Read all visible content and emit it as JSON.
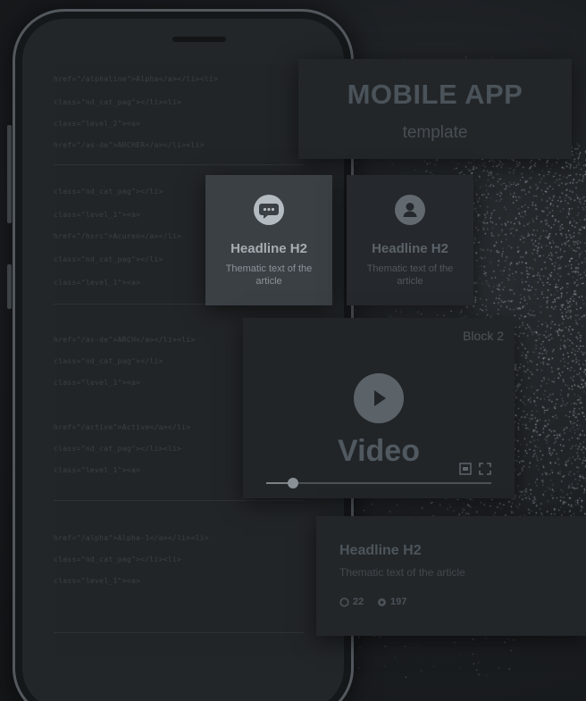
{
  "header": {
    "title": "MOBILE APP",
    "subtitle": "template"
  },
  "features": [
    {
      "icon": "chat-bubble-icon",
      "headline": "Headline H2",
      "text": "Thematic text of the article"
    },
    {
      "icon": "user-icon",
      "headline": "Headline H2",
      "text": "Thematic text of the article"
    }
  ],
  "video_block": {
    "label": "Block 2",
    "title": "Video",
    "progress": 0.12
  },
  "article": {
    "headline": "Headline H2",
    "text": "Thematic text of the article",
    "comments": "22",
    "views": "197"
  },
  "code_lines": [
    "href=\"/alphaline\">Alpha&lt;/a>&lt;/li>&lt;li>",
    "class=\"nd_cat_pag\">&lt;/li>&lt;li>",
    "class=\"level_2\">&lt;a>",
    "href=\"/as-de\">ARCHER&lt;/a>&lt;/li>&lt;li>",
    "class=\"nd_cat_pag\">&lt;/li>",
    "class=\"level_1\">&lt;a>",
    "href=\"/hsrc\">Acuren&lt;/a>&lt;/li>",
    "class=\"nd_cat_pag\">&lt;/li>",
    "class=\"level_1\">&lt;a>",
    "href=\"/as-de\">ARCH&lt;/a>&lt;/li>&lt;li>",
    "class=\"nd_cat_pag\">&lt;/li>",
    "class=\"level_1\">&lt;a>",
    "href=\"/active\">Active&lt;/a>&lt;/li>",
    "class=\"nd_cat_pag\">&lt;/li>&lt;li>",
    "class=\"level_1\">&lt;a>",
    "href=\"/alpha\">Alpha-1&lt;/a>&lt;/li>&lt;li>",
    "class=\"nd_cat_pag\">&lt;/li>&lt;li>",
    "class=\"level_1\">&lt;a>"
  ]
}
